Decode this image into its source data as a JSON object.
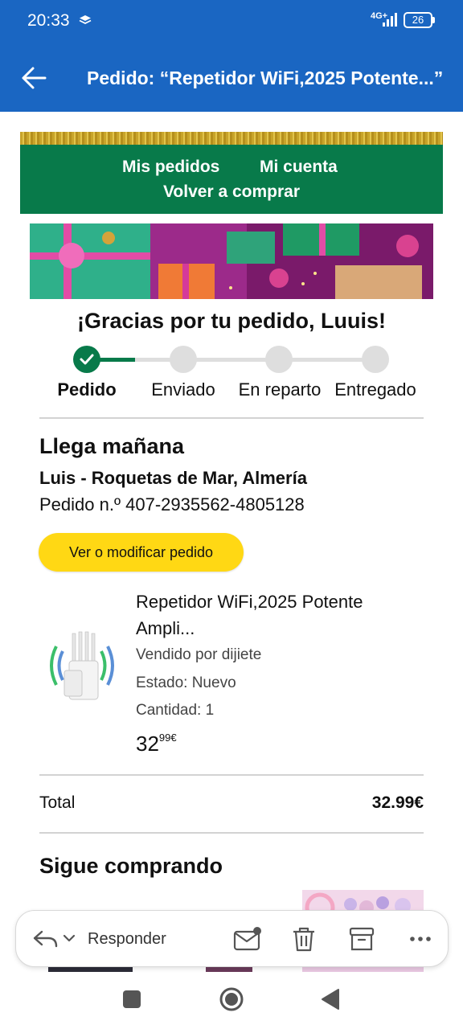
{
  "status_bar": {
    "time": "20:33",
    "network": "4G+",
    "battery": "26"
  },
  "app_bar": {
    "title": "Pedido: “Repetidor WiFi,2025 Potente...”"
  },
  "email_nav": {
    "my_orders": "Mis pedidos",
    "my_account": "Mi cuenta",
    "buy_again": "Volver a comprar"
  },
  "thanks": "¡Gracias por tu pedido, Luuis!",
  "tracker": {
    "steps": [
      "Pedido",
      "Enviado",
      "En reparto",
      "Entregado"
    ],
    "completed_steps": 1
  },
  "delivery": {
    "arrives": "Llega mañana",
    "address": "Luis - Roquetas de Mar, Almería",
    "order_number": "Pedido n.º 407-2935562-4805128"
  },
  "modify_button": "Ver o modificar pedido",
  "product": {
    "title": "Repetidor WiFi,2025 Potente Ampli...",
    "seller": "Vendido por dijiete",
    "condition": "Estado: Nuevo",
    "quantity": "Cantidad: 1",
    "price_whole": "32",
    "price_fraction": "99€"
  },
  "total": {
    "label": "Total",
    "value": "32.99€"
  },
  "keep_shopping": "Sigue comprando",
  "action_bar": {
    "reply_label": "Responder",
    "icons": [
      "reply-icon",
      "chevron-down-icon",
      "mark-unread-icon",
      "trash-icon",
      "archive-icon",
      "more-icon"
    ]
  },
  "colors": {
    "app_bar": "#1a66c2",
    "email_nav": "#087a4a",
    "button_yellow": "#ffd814",
    "tracker_done": "#087a4a",
    "tracker_pending": "#dedede"
  }
}
